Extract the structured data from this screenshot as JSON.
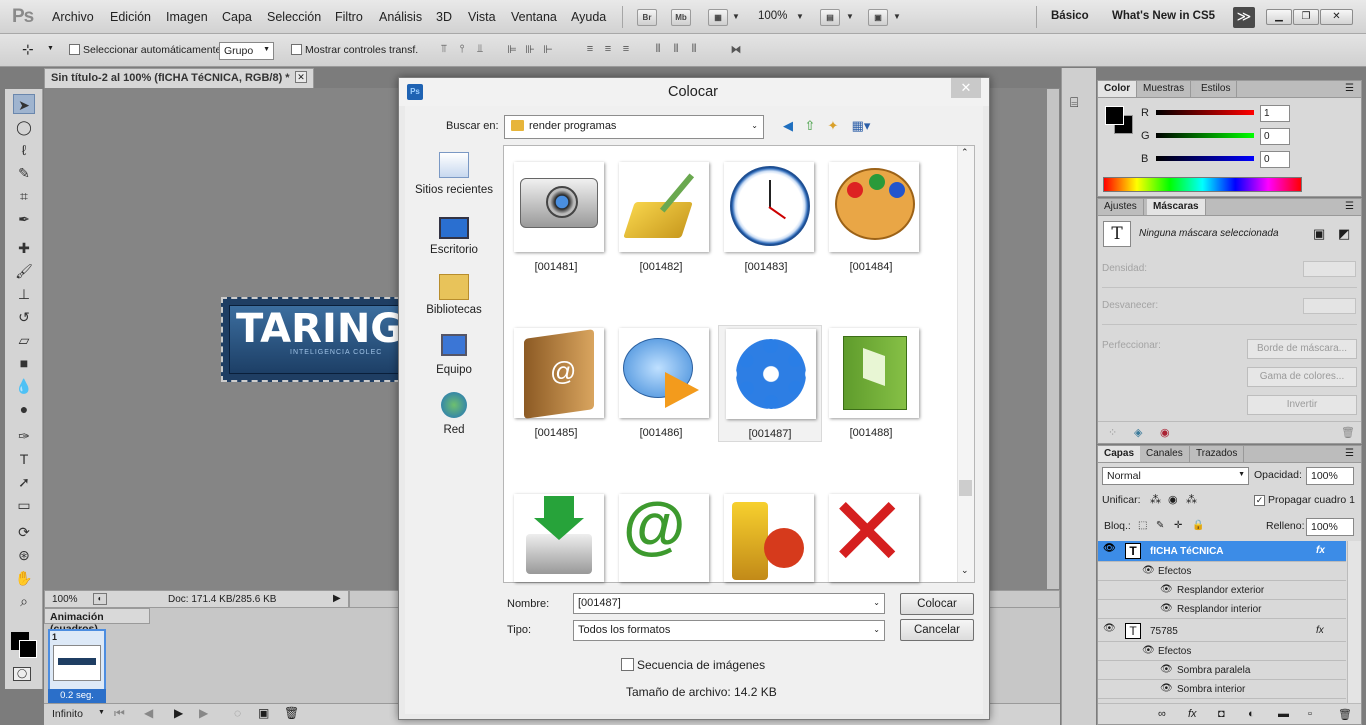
{
  "menubar": {
    "app_logo": "Ps",
    "items": [
      "Archivo",
      "Edición",
      "Imagen",
      "Capa",
      "Selección",
      "Filtro",
      "Análisis",
      "3D",
      "Vista",
      "Ventana",
      "Ayuda"
    ],
    "bridge": "Br",
    "minibridge": "Mb",
    "zoom": "100%",
    "workspaces": [
      "Básico",
      "What's New in CS5"
    ],
    "more": "≫"
  },
  "options": {
    "auto_select_label": "Seleccionar automáticamente:",
    "auto_select_value": "Grupo",
    "show_transform_label": "Mostrar controles transf."
  },
  "document": {
    "tab_title": "Sin título-2 al 100% (fICHA TéCNICA, RGB/8) *",
    "canvas_text": "TARINGA",
    "canvas_subtext": "INTELIGENCIA COLEC",
    "zoom": "100%",
    "doc_info": "Doc: 171.4 KB/285.6 KB"
  },
  "animation": {
    "title": "Animación (cuadros)",
    "frame_number": "1",
    "frame_time": "0.2 seg.",
    "loop": "Infinito"
  },
  "color_panel": {
    "tabs": [
      "Color",
      "Muestras",
      "Estilos"
    ],
    "channels": [
      {
        "label": "R",
        "value": "1"
      },
      {
        "label": "G",
        "value": "0"
      },
      {
        "label": "B",
        "value": "0"
      }
    ]
  },
  "masks_panel": {
    "tabs": [
      "Ajustes",
      "Máscaras"
    ],
    "status": "Ninguna máscara seleccionada",
    "density": "Densidad:",
    "feather": "Desvanecer:",
    "refine": "Perfeccionar:",
    "buttons": [
      "Borde de máscara...",
      "Gama de colores...",
      "Invertir"
    ]
  },
  "layers_panel": {
    "tabs": [
      "Capas",
      "Canales",
      "Trazados"
    ],
    "blend_mode": "Normal",
    "opacity_label": "Opacidad:",
    "opacity": "100%",
    "unify_label": "Unificar:",
    "propagate_label": "Propagar cuadro 1",
    "lock_label": "Bloq.:",
    "fill_label": "Relleno:",
    "fill": "100%",
    "layers": [
      {
        "name": "fICHA TéCNICA",
        "fx": "fx"
      },
      {
        "name": "Efectos"
      },
      {
        "name": "Resplandor exterior"
      },
      {
        "name": "Resplandor interior"
      },
      {
        "name": "75785",
        "fx": "fx"
      },
      {
        "name": "Efectos"
      },
      {
        "name": "Sombra paralela"
      },
      {
        "name": "Sombra interior"
      }
    ]
  },
  "dialog": {
    "title": "Colocar",
    "look_in_label": "Buscar en:",
    "look_in_value": "render programas",
    "places": [
      "Sitios recientes",
      "Escritorio",
      "Bibliotecas",
      "Equipo",
      "Red"
    ],
    "files": [
      "[001481]",
      "[001482]",
      "[001483]",
      "[001484]",
      "[001485]",
      "[001486]",
      "[001487]",
      "[001488]"
    ],
    "name_label": "Nombre:",
    "name_value": "[001487]",
    "type_label": "Tipo:",
    "type_value": "Todos los formatos",
    "place_button": "Colocar",
    "cancel_button": "Cancelar",
    "sequence_label": "Secuencia de imágenes",
    "file_size": "Tamaño de archivo: 14.2 KB"
  },
  "colors": {
    "accent": "#3c8ce7",
    "selection": "#5a9de8"
  }
}
